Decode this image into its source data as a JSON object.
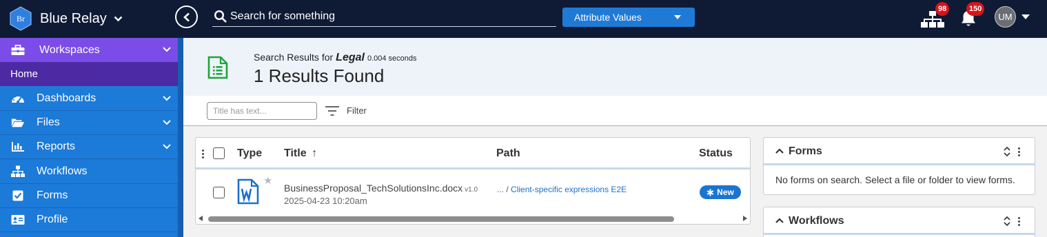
{
  "app": {
    "logo_text": "Br",
    "name": "Blue Relay"
  },
  "topbar": {
    "search_placeholder": "Search for something",
    "attribute_button": "Attribute Values",
    "org_badge": "98",
    "notifications_badge": "150",
    "avatar_initials": "UM"
  },
  "sidebar": {
    "workspaces": "Workspaces",
    "home": "Home",
    "items": [
      {
        "label": "Dashboards",
        "icon": "gauge-icon",
        "has_chevron": true
      },
      {
        "label": "Files",
        "icon": "folder-open-icon",
        "has_chevron": true
      },
      {
        "label": "Reports",
        "icon": "bar-chart-icon",
        "has_chevron": true
      },
      {
        "label": "Workflows",
        "icon": "sitemap-icon",
        "has_chevron": false
      },
      {
        "label": "Forms",
        "icon": "checkbox-icon",
        "has_chevron": false
      },
      {
        "label": "Profile",
        "icon": "id-card-icon",
        "has_chevron": false
      }
    ]
  },
  "results": {
    "prefix": "Search Results for",
    "term": "Legal",
    "time": "0.004 seconds",
    "count_text": "1 Results Found"
  },
  "filter": {
    "placeholder": "Title has text...",
    "label": "Filter"
  },
  "table": {
    "columns": {
      "type": "Type",
      "title": "Title",
      "title_sort": "↑",
      "path": "Path",
      "status": "Status"
    },
    "rows": [
      {
        "file_name": "BusinessProposal_TechSolutionsInc.docx",
        "version": "v1.0",
        "date": "2025-04-23 10:20am",
        "path_ellipsis": "...",
        "path_sep": "/",
        "path_folder": "Client-specific expressions E2E",
        "status": "New",
        "file_icon": "word-doc-icon"
      }
    ]
  },
  "cards": {
    "forms": {
      "title": "Forms",
      "message": "No forms on search. Select a file or folder to view forms."
    },
    "workflows": {
      "title": "Workflows"
    }
  },
  "colors": {
    "topbar": "#0f1b35",
    "sidebar": "#1c7ad9",
    "workspaces": "#7b4ce8",
    "home": "#4c2aa3",
    "accent": "#1f7ad6",
    "badge": "#d7141a"
  }
}
